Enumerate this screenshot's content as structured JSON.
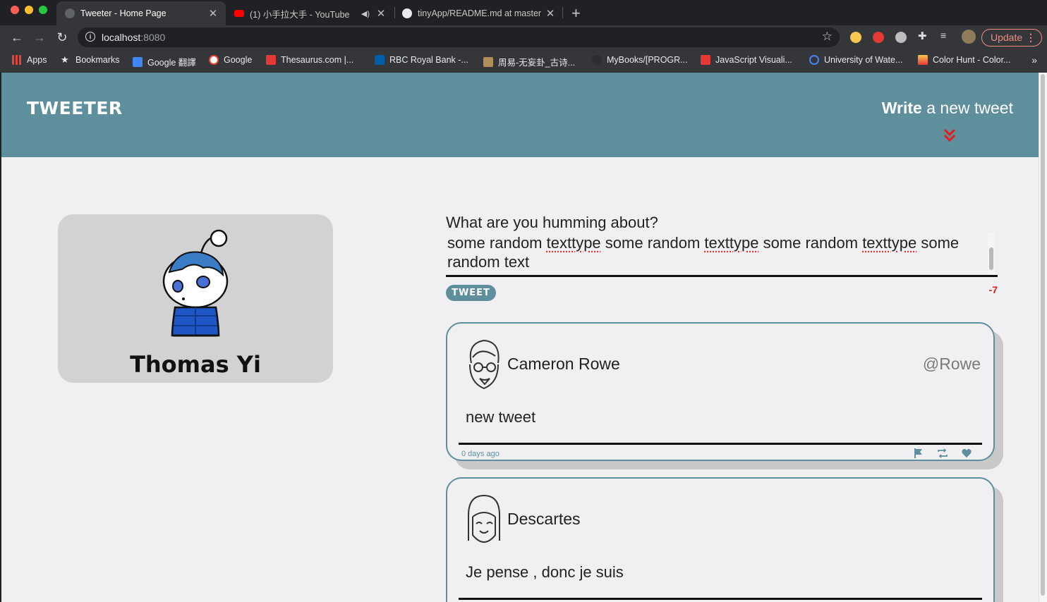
{
  "browser": {
    "tabs": [
      {
        "title": "Tweeter - Home Page",
        "active": true,
        "favicon": "globe-icon"
      },
      {
        "title": "(1) 小手拉大手 - YouTube",
        "active": false,
        "favicon": "youtube-icon",
        "audio": true
      },
      {
        "title": "tinyApp/README.md at master",
        "active": false,
        "favicon": "github-icon"
      }
    ],
    "address": {
      "host": "localhost",
      "port": ":8080"
    },
    "update_label": "Update",
    "bookmarks": [
      "Apps",
      "Bookmarks",
      "Google 翻譯",
      "Google",
      "Thesaurus.com |...",
      "RBC Royal Bank -...",
      "周易-无妄卦_古诗...",
      "MyBooks/[PROGR...",
      "JavaScript Visuali...",
      "University of Wate...",
      "Color Hunt - Color..."
    ]
  },
  "header": {
    "brand": "TWEETER",
    "write_bold": "Write",
    "write_rest": " a new tweet"
  },
  "profile": {
    "name": "Thomas Yi"
  },
  "composer": {
    "label": "What are you humming about?",
    "text_parts": [
      "some random ",
      "texttype",
      " some random ",
      "texttype",
      " some random ",
      "texttype",
      " some random text"
    ],
    "button_label": "TWEET",
    "counter": "-7"
  },
  "tweets": [
    {
      "name": "Cameron Rowe",
      "handle": "@Rowe",
      "content": "new tweet",
      "time": "0 days ago"
    },
    {
      "name": "Descartes",
      "handle": "",
      "content": "Je pense , donc je suis",
      "time": ""
    }
  ],
  "colors": {
    "accent": "#5f8f9c",
    "counter_negative": "#e21b1b",
    "chevron": "#e21b1b"
  }
}
